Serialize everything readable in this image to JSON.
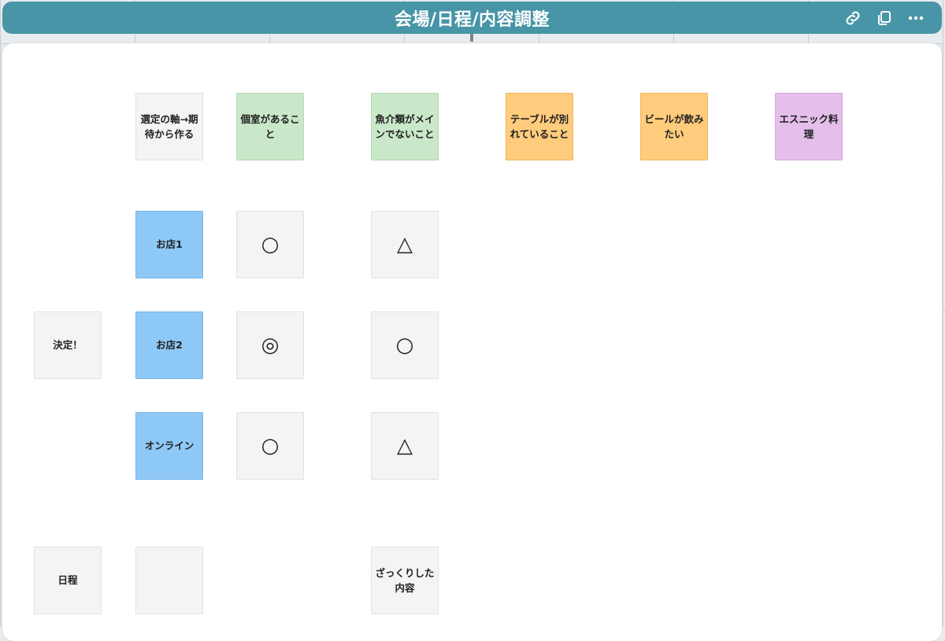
{
  "frame": {
    "title": "会場/日程/内容調整",
    "icons": [
      "link-icon",
      "copy-icon",
      "more-icon"
    ]
  },
  "headers": {
    "axis": "選定の軸→期待から作る",
    "crit1": "個室があること",
    "crit2": "魚介類がメインでないこと",
    "crit3": "テーブルが別れていること",
    "crit4": "ビールが飲みたい",
    "crit5": "エスニック料理"
  },
  "rows": {
    "shop1": "お店1",
    "shop2": "お店2",
    "online": "オンライン"
  },
  "marks": {
    "shop1_c1": "○",
    "shop1_c2": "△",
    "shop2_c1": "◎",
    "shop2_c2": "○",
    "online_c1": "○",
    "online_c2": "△"
  },
  "decision": "決定！",
  "schedule": {
    "label": "日程",
    "blank": "",
    "content": "ざっくりした内容"
  },
  "colors": {
    "header": "#4795a7",
    "plain": "#f4f4f4",
    "green": "#c9e7c9",
    "orange": "#ffcb7d",
    "purple": "#e3bfe9",
    "blue": "#8ec8f6"
  }
}
